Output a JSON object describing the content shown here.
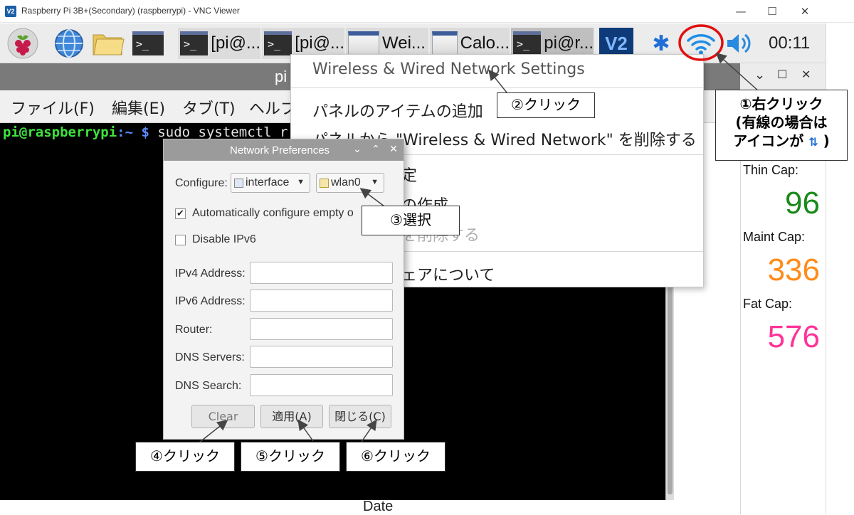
{
  "vnc_window": {
    "logo_text": "V2",
    "title": "Raspberry Pi 3B+(Secondary) (raspberrypi) - VNC Viewer",
    "minimize": "—",
    "maximize": "☐",
    "close": "✕"
  },
  "taskbar": {
    "tasks": [
      {
        "label": "[pi@...",
        "icon": "terminal-icon"
      },
      {
        "label": "[pi@...",
        "icon": "terminal-icon"
      },
      {
        "label": "Wei...",
        "icon": "window-icon"
      },
      {
        "label": "Calo...",
        "icon": "window-icon"
      },
      {
        "label": "pi@r...",
        "icon": "terminal-icon"
      }
    ],
    "launcher_terminal_glyph": ">_",
    "vnc_tray_text": "V2",
    "bluetooth_glyph": "✱",
    "clock": "00:11"
  },
  "terminal": {
    "title": "pi",
    "menu": [
      "ファイル(F)",
      "編集(E)",
      "タブ(T)",
      "ヘルプ"
    ],
    "prompt_user": "pi@raspberrypi",
    "prompt_sep": ":~ $ ",
    "command": "sudo systemctl r"
  },
  "below_terminal": {
    "label": "Date"
  },
  "right_panel": {
    "window_buttons": [
      "⌄",
      "☐",
      "✕"
    ],
    "stats": [
      {
        "label": "Thin Cap:",
        "value": "96",
        "color": "#1a8a1a"
      },
      {
        "label": "Maint Cap:",
        "value": "336",
        "color": "#ff8c1a"
      },
      {
        "label": "Fat Cap:",
        "value": "576",
        "color": "#ff3399"
      }
    ]
  },
  "context_menu": {
    "items": [
      "Wireless & Wired Network Settings",
      "パネルのアイテムの追加",
      "パネルから \"Wireless & Wired Network\" を削除する",
      "定",
      "の作成",
      "を削除する",
      "ェアについて"
    ]
  },
  "network_dialog": {
    "title": "Network Preferences",
    "titlebar_buttons": [
      "⌄",
      "⌃",
      "✕"
    ],
    "configure_label": "Configure:",
    "configure_type": "interface",
    "configure_value": "wlan0",
    "auto_configure_label": "Automatically configure empty o",
    "auto_configure_checked": true,
    "disable_ipv6_label": "Disable IPv6",
    "disable_ipv6_checked": false,
    "fields": [
      {
        "label": "IPv4 Address:",
        "value": ""
      },
      {
        "label": "IPv6 Address:",
        "value": ""
      },
      {
        "label": "Router:",
        "value": ""
      },
      {
        "label": "DNS Servers:",
        "value": ""
      },
      {
        "label": "DNS Search:",
        "value": ""
      }
    ],
    "buttons": {
      "clear": "Clear",
      "apply": "適用(A)",
      "close": "閉じる(C)"
    }
  },
  "annotations": {
    "step1_line1": "①右クリック",
    "step1_line2": "(有線の場合は",
    "step1_line3": "アイコンが",
    "step1_icon": "⇅",
    "step1_paren": ")",
    "step2": "②クリック",
    "step3": "③選択",
    "step4": "④クリック",
    "step5": "⑤クリック",
    "step6": "⑥クリック",
    "highlight_color": "#e01010",
    "arrow_color": "#444444"
  }
}
